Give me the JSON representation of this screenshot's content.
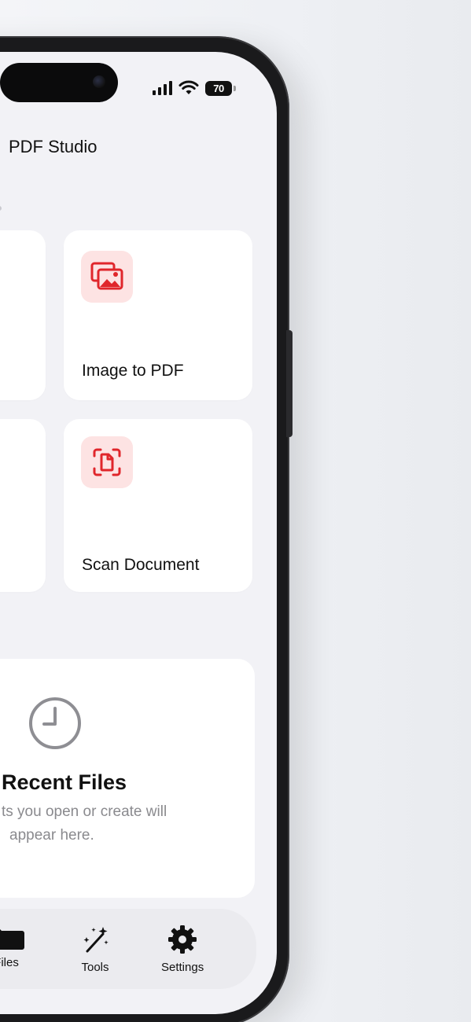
{
  "status_bar": {
    "battery_level": "70",
    "icons": [
      "cellular-signal-icon",
      "wifi-icon",
      "battery-icon"
    ]
  },
  "app": {
    "title": "PDF Studio"
  },
  "tools": [
    {
      "label": "Image to PDF",
      "icon": "image-gallery-icon"
    },
    {
      "label": "Scan Document",
      "icon": "document-scan-icon"
    }
  ],
  "recent": {
    "title": "Recent Files",
    "subtitle_line1": "ts you open or create will",
    "subtitle_line2": "appear here.",
    "icon": "clock-icon"
  },
  "tab_bar": {
    "tabs": [
      {
        "label": "Files",
        "icon": "folder-icon"
      },
      {
        "label": "Tools",
        "icon": "magic-wand-icon"
      },
      {
        "label": "Settings",
        "icon": "gear-icon"
      }
    ]
  },
  "colors": {
    "accent": "#e0262b",
    "accent_tile": "#fde3e3",
    "background": "#f2f2f6"
  }
}
